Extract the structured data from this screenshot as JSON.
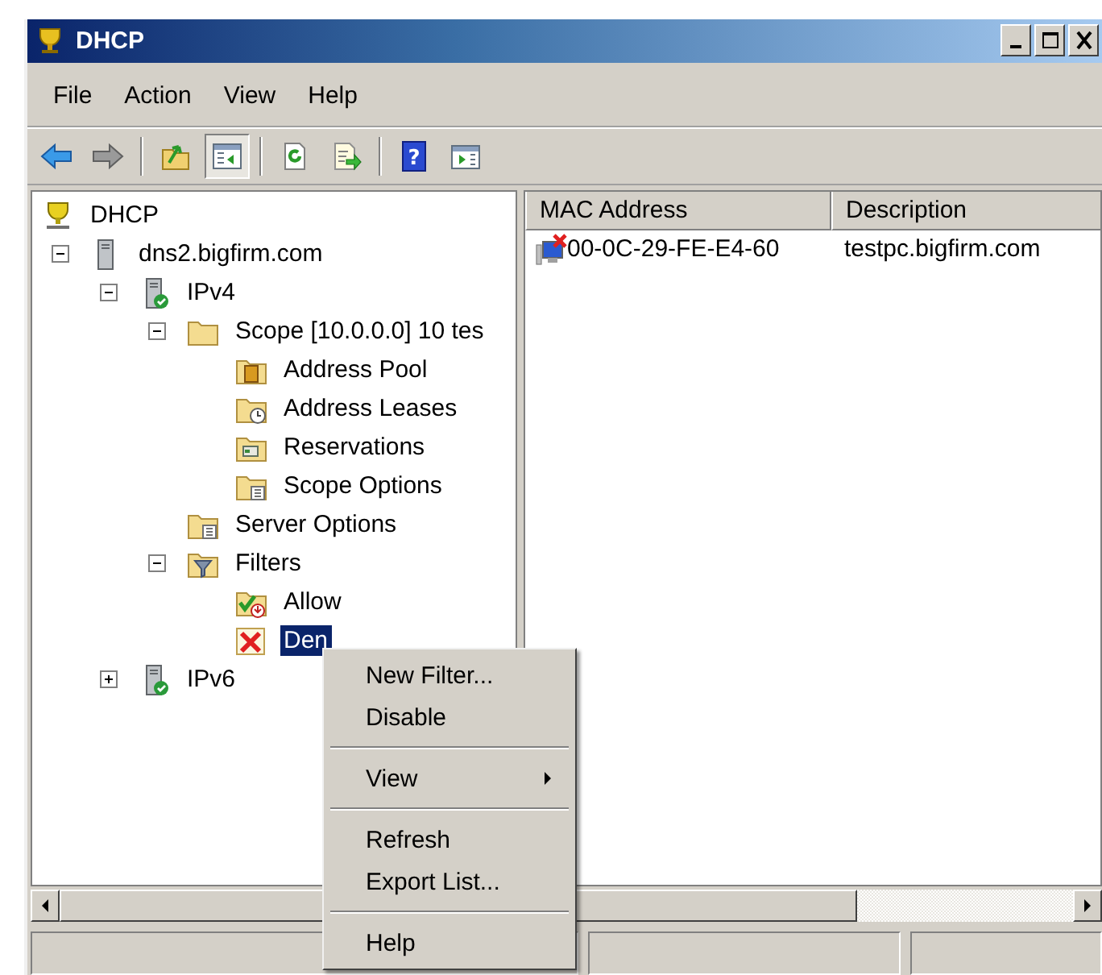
{
  "window": {
    "title": "DHCP"
  },
  "menu_bar": [
    "File",
    "Action",
    "View",
    "Help"
  ],
  "toolbar": [
    {
      "kind": "back",
      "pressed": false
    },
    {
      "kind": "forward",
      "pressed": false
    },
    {
      "kind": "separator"
    },
    {
      "kind": "up",
      "pressed": false
    },
    {
      "kind": "tree",
      "pressed": true
    },
    {
      "kind": "separator"
    },
    {
      "kind": "refresh",
      "pressed": false
    },
    {
      "kind": "export",
      "pressed": false
    },
    {
      "kind": "separator"
    },
    {
      "kind": "help",
      "label": "?",
      "pressed": false
    },
    {
      "kind": "action-pane",
      "pressed": false
    }
  ],
  "tree": [
    {
      "label": "DHCP",
      "kind": "dhcp",
      "selected": false,
      "children": [
        {
          "label": "dns2.bigfirm.com",
          "kind": "server",
          "expanded": true,
          "selected": false,
          "children": [
            {
              "label": "IPv4",
              "kind": "server-ok",
              "expanded": true,
              "selected": false,
              "children": [
                {
                  "label": "Scope [10.0.0.0] 10 tes",
                  "kind": "folder",
                  "expanded": true,
                  "selected": false,
                  "children": [
                    {
                      "label": "Address Pool",
                      "kind": "pool",
                      "selected": false
                    },
                    {
                      "label": "Address Leases",
                      "kind": "leases",
                      "selected": false
                    },
                    {
                      "label": "Reservations",
                      "kind": "reservations",
                      "selected": false
                    },
                    {
                      "label": "Scope Options",
                      "kind": "options",
                      "selected": false
                    }
                  ]
                },
                {
                  "label": "Server Options",
                  "kind": "options",
                  "selected": false
                },
                {
                  "label": "Filters",
                  "kind": "filter",
                  "expanded": true,
                  "selected": false,
                  "children": [
                    {
                      "label": "Allow",
                      "kind": "allow",
                      "selected": false
                    },
                    {
                      "label": "Den",
                      "kind": "deny",
                      "selected": true
                    }
                  ]
                }
              ]
            },
            {
              "label": "IPv6",
              "kind": "server-ok",
              "expanded": false,
              "selected": false
            }
          ]
        }
      ]
    }
  ],
  "table": {
    "columns": [
      "MAC Address",
      "Description"
    ],
    "rows": [
      {
        "cells": [
          "00-0C-29-FE-E4-60",
          "testpc.bigfirm.com"
        ],
        "denied": true
      }
    ]
  },
  "context_menu": [
    {
      "kind": "item",
      "label": "New Filter..."
    },
    {
      "kind": "item",
      "label": "Disable"
    },
    {
      "kind": "separator"
    },
    {
      "kind": "submenu",
      "label": "View"
    },
    {
      "kind": "separator"
    },
    {
      "kind": "item",
      "label": "Refresh"
    },
    {
      "kind": "item",
      "label": "Export List..."
    },
    {
      "kind": "separator"
    },
    {
      "kind": "item",
      "label": "Help"
    }
  ]
}
